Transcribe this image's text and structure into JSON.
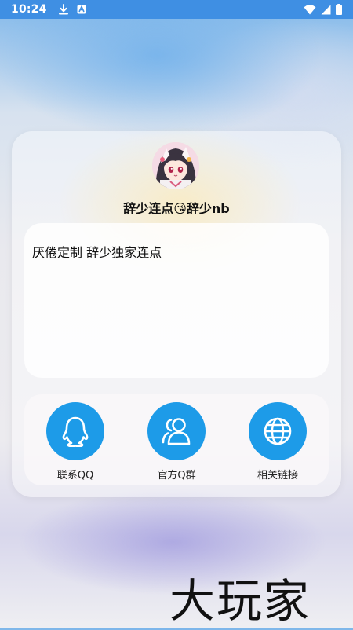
{
  "status_bar": {
    "time": "10:24",
    "icons": [
      "download-icon",
      "app-icon",
      "wifi-icon",
      "signal-icon",
      "battery-icon"
    ]
  },
  "profile": {
    "name": "辞少连点😘辞少nb",
    "avatar_icon": "anime-avatar-icon"
  },
  "notice": {
    "text": "厌倦定制 辞少独家连点"
  },
  "actions": [
    {
      "label": "联系QQ",
      "icon": "qq-penguin-icon"
    },
    {
      "label": "官方Q群",
      "icon": "group-users-icon"
    },
    {
      "label": "相关链接",
      "icon": "globe-icon"
    }
  ],
  "watermark": {
    "text": "大玩家"
  },
  "colors": {
    "status_bar": "#3f8fe3",
    "accent": "#1d9be8"
  }
}
